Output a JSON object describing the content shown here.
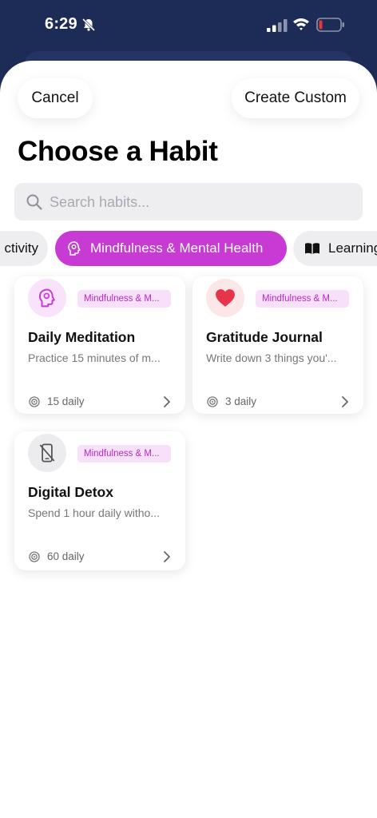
{
  "status_bar": {
    "time": "6:29",
    "icons": [
      "bell-slash-icon",
      "signal-icon",
      "wifi-icon",
      "battery-low-icon"
    ]
  },
  "header": {
    "cancel_label": "Cancel",
    "create_custom_label": "Create Custom",
    "title": "Choose a Habit"
  },
  "search": {
    "placeholder": "Search habits...",
    "value": ""
  },
  "categories": [
    {
      "label": "Productivity",
      "visible_label": "ctivity",
      "icon": "none",
      "selected": false
    },
    {
      "label": "Mindfulness & Mental Health",
      "icon": "head-icon",
      "selected": true
    },
    {
      "label": "Learning",
      "icon": "book-icon",
      "selected": false
    }
  ],
  "habits": [
    {
      "title": "Daily Meditation",
      "badge": "Mindfulness & M...",
      "description": "Practice 15 minutes of m...",
      "frequency": "15 daily",
      "icon": "head-icon"
    },
    {
      "title": "Gratitude Journal",
      "badge": "Mindfulness & M...",
      "description": "Write down 3 things you'...",
      "frequency": "3 daily",
      "icon": "heart-icon"
    },
    {
      "title": "Digital Detox",
      "badge": "Mindfulness & M...",
      "description": "Spend 1 hour daily witho...",
      "frequency": "60 daily",
      "icon": "phone-off-icon"
    }
  ],
  "colors": {
    "accent": "#c73ad3",
    "badge_bg": "#f8e0fb",
    "badge_text": "#b52ac3",
    "header_bg": "#1d2b57",
    "heart": "#e8344a"
  }
}
